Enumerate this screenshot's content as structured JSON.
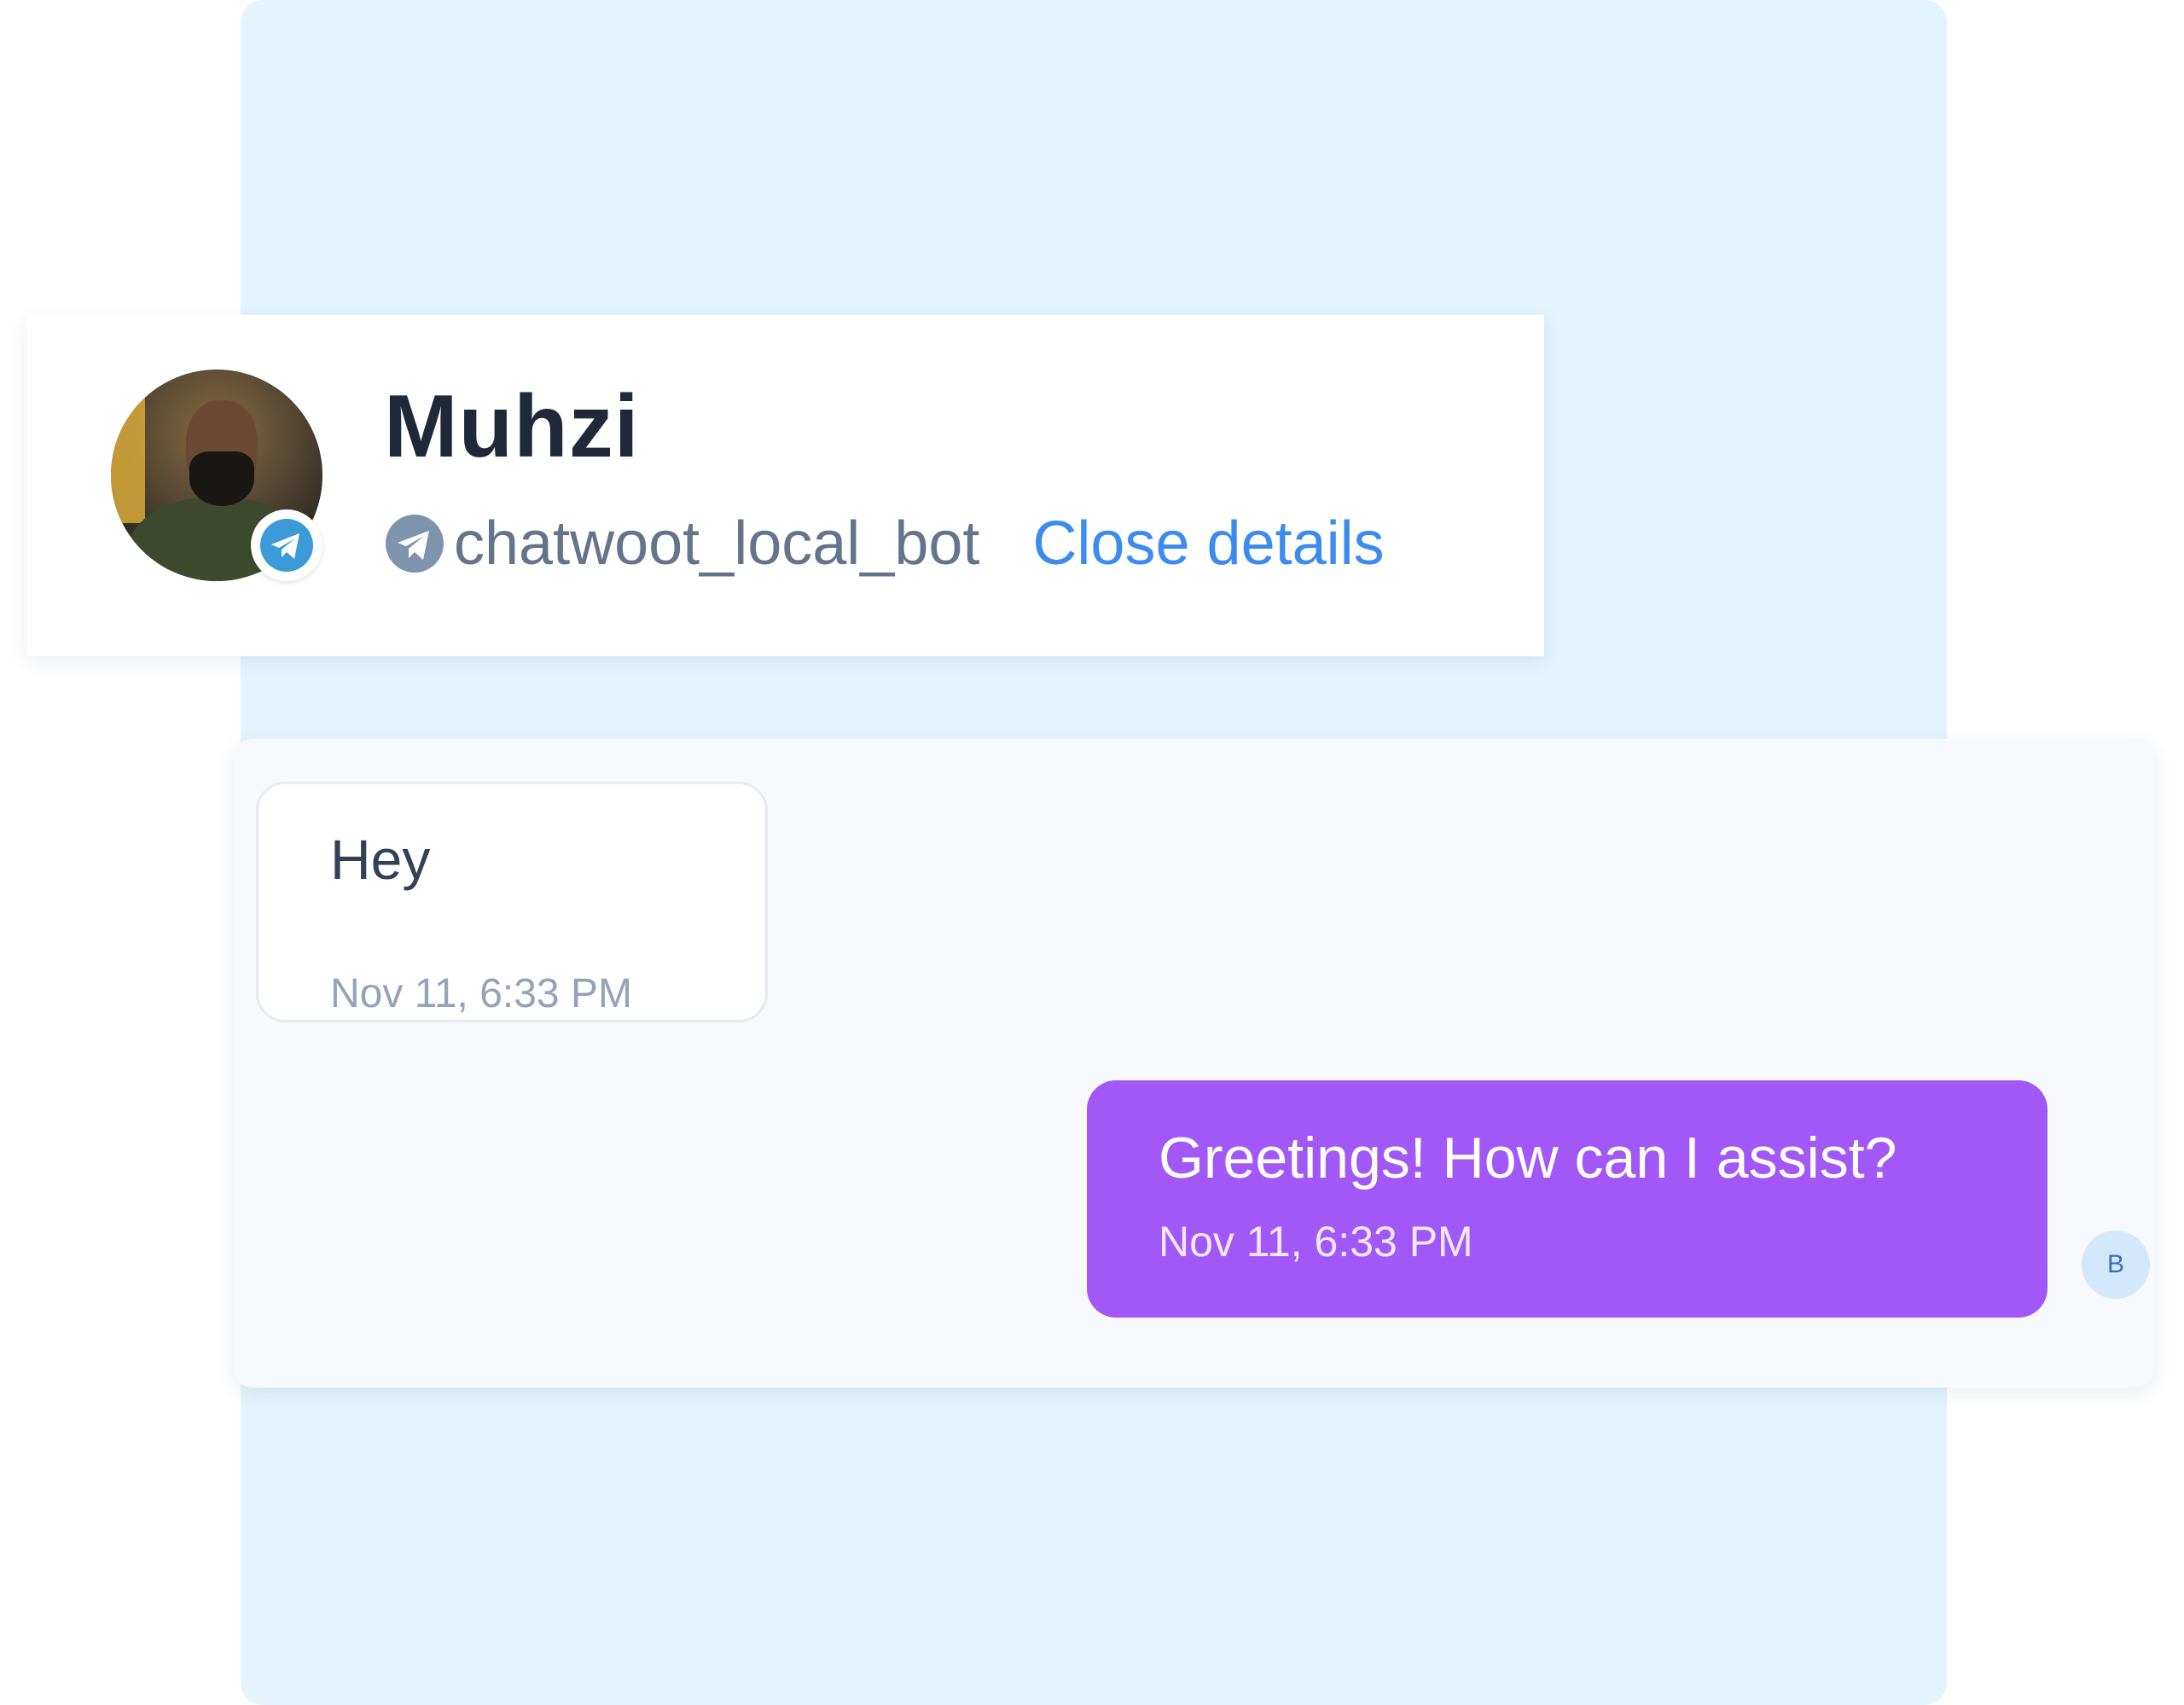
{
  "contact": {
    "name": "Muhzi",
    "inbox_name": "chatwoot_local_bot",
    "close_details_label": "Close details",
    "channel_icon": "telegram-icon"
  },
  "messages": [
    {
      "direction": "incoming",
      "text": "Hey",
      "timestamp": "Nov 11, 6:33 PM"
    },
    {
      "direction": "outgoing",
      "text": "Greetings! How can I assist?",
      "timestamp": "Nov 11, 6:33 PM",
      "sender_initial": "B"
    }
  ],
  "colors": {
    "background_panel": "#e3f4fd",
    "accent_link": "#3b8bf0",
    "outgoing_bubble": "#a258f7",
    "telegram_blue": "#3d9ad9"
  }
}
